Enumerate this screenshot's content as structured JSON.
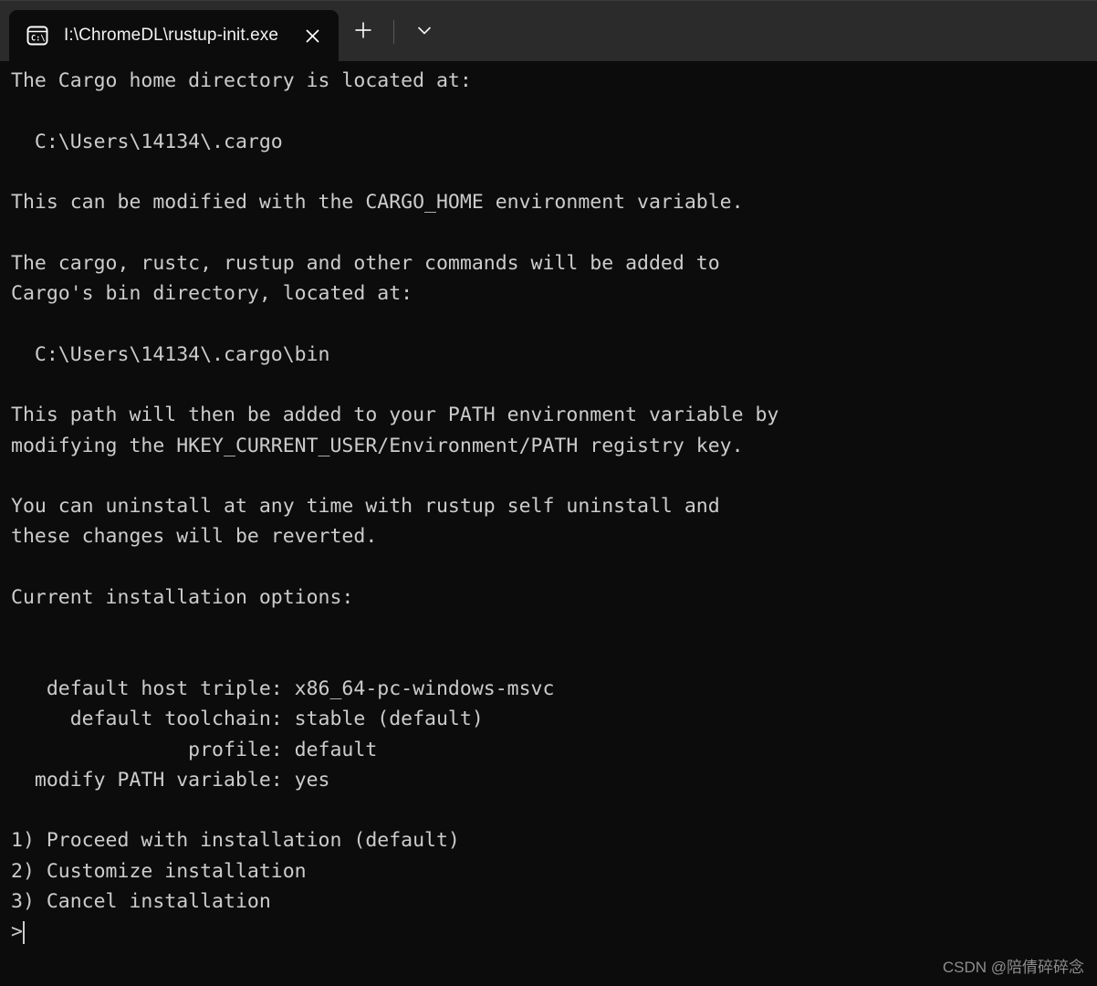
{
  "window": {
    "titlebar": {
      "tab": {
        "icon": "command-prompt-icon",
        "title": "I:\\ChromeDL\\rustup-init.exe",
        "close_label": "✕"
      },
      "new_tab_label": "+",
      "dropdown_label": "⌄"
    },
    "colors": {
      "titlebar_bg": "#2b2b2b",
      "tab_bg": "#0c0c0c",
      "terminal_bg": "#0c0c0c",
      "terminal_fg": "#cccccc",
      "tab_title_fg": "#f2f2f2"
    }
  },
  "terminal": {
    "output": "The Cargo home directory is located at:\n\n  C:\\Users\\14134\\.cargo\n\nThis can be modified with the CARGO_HOME environment variable.\n\nThe cargo, rustc, rustup and other commands will be added to\nCargo's bin directory, located at:\n\n  C:\\Users\\14134\\.cargo\\bin\n\nThis path will then be added to your PATH environment variable by\nmodifying the HKEY_CURRENT_USER/Environment/PATH registry key.\n\nYou can uninstall at any time with rustup self uninstall and\nthese changes will be reverted.\n\nCurrent installation options:\n\n\n   default host triple: x86_64-pc-windows-msvc\n     default toolchain: stable (default)\n               profile: default\n  modify PATH variable: yes\n\n1) Proceed with installation (default)\n2) Customize installation\n3) Cancel installation\n>",
    "prompt_symbol": ">",
    "options": [
      {
        "number": "1)",
        "label": "Proceed with installation (default)"
      },
      {
        "number": "2)",
        "label": "Customize installation"
      },
      {
        "number": "3)",
        "label": "Cancel installation"
      }
    ],
    "installation_options": [
      {
        "label": "default host triple:",
        "value": "x86_64-pc-windows-msvc"
      },
      {
        "label": "default toolchain:",
        "value": "stable (default)"
      },
      {
        "label": "profile:",
        "value": "default"
      },
      {
        "label": "modify PATH variable:",
        "value": "yes"
      }
    ],
    "paths": {
      "cargo_home": "C:\\Users\\14134\\.cargo",
      "cargo_bin": "C:\\Users\\14134\\.cargo\\bin"
    }
  },
  "watermark": {
    "text": "CSDN @陪倩碎碎念"
  }
}
